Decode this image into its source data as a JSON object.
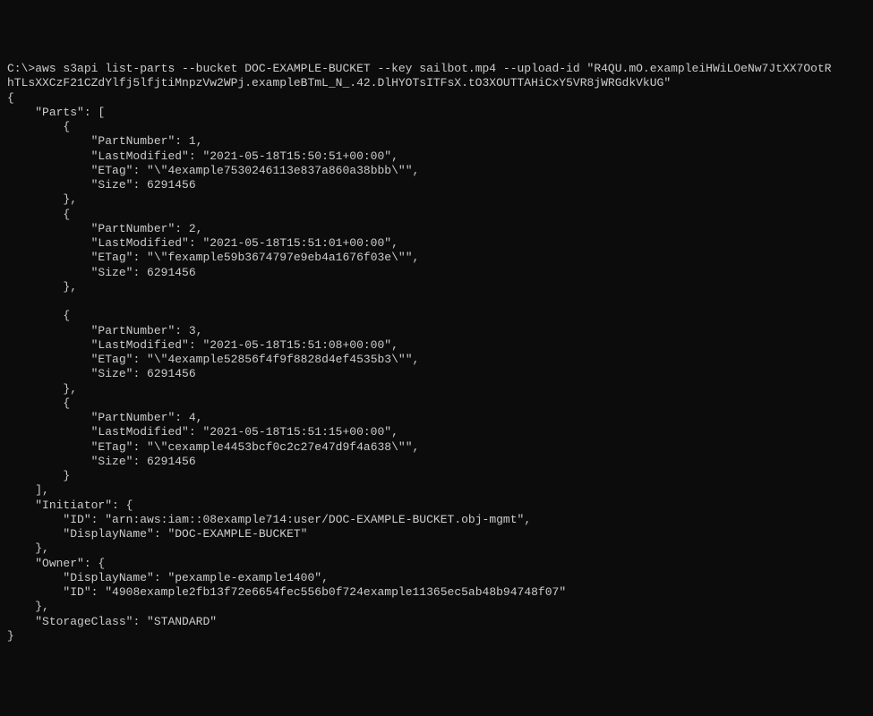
{
  "command": {
    "prompt": "C:\\>",
    "line1": "aws s3api list-parts --bucket DOC-EXAMPLE-BUCKET --key sailbot.mp4 --upload-id \"R4QU.mO.exampleiHWiLOeNw7JtXX7OotR",
    "line2": "hTLsXXCzF21CZdYlfj5lfjtiMnpzVw2WPj.exampleBTmL_N_.42.DlHYOTsITFsX.tO3XOUTTAHiCxY5VR8jWRGdkVkUG\""
  },
  "output": {
    "parts": [
      {
        "PartNumber": 1,
        "LastModified": "\"2021-05-18T15:50:51+00:00\"",
        "ETag": "\"\\\"4example7530246113e837a860a38bbb\\\"\"",
        "Size": 6291456
      },
      {
        "PartNumber": 2,
        "LastModified": "\"2021-05-18T15:51:01+00:00\"",
        "ETag": "\"\\\"fexample59b3674797e9eb4a1676f03e\\\"\"",
        "Size": 6291456
      },
      {
        "PartNumber": 3,
        "LastModified": "\"2021-05-18T15:51:08+00:00\"",
        "ETag": "\"\\\"4example52856f4f9f8828d4ef4535b3\\\"\"",
        "Size": 6291456
      },
      {
        "PartNumber": 4,
        "LastModified": "\"2021-05-18T15:51:15+00:00\"",
        "ETag": "\"\\\"cexample4453bcf0c2c27e47d9f4a638\\\"\"",
        "Size": 6291456
      }
    ],
    "initiator": {
      "ID": "\"arn:aws:iam::08example714:user/DOC-EXAMPLE-BUCKET.obj-mgmt\"",
      "DisplayName": "\"DOC-EXAMPLE-BUCKET\""
    },
    "owner": {
      "DisplayName": "\"pexample-example1400\"",
      "ID": "\"4908example2fb13f72e6654fec556b0f724example11365ec5ab48b94748f07\""
    },
    "storageClass": "\"STANDARD\""
  },
  "labels": {
    "parts": "\"Parts\"",
    "partNumber": "\"PartNumber\"",
    "lastModified": "\"LastModified\"",
    "etag": "\"ETag\"",
    "size": "\"Size\"",
    "initiator": "\"Initiator\"",
    "id": "\"ID\"",
    "displayName": "\"DisplayName\"",
    "owner": "\"Owner\"",
    "storageClass": "\"StorageClass\""
  }
}
